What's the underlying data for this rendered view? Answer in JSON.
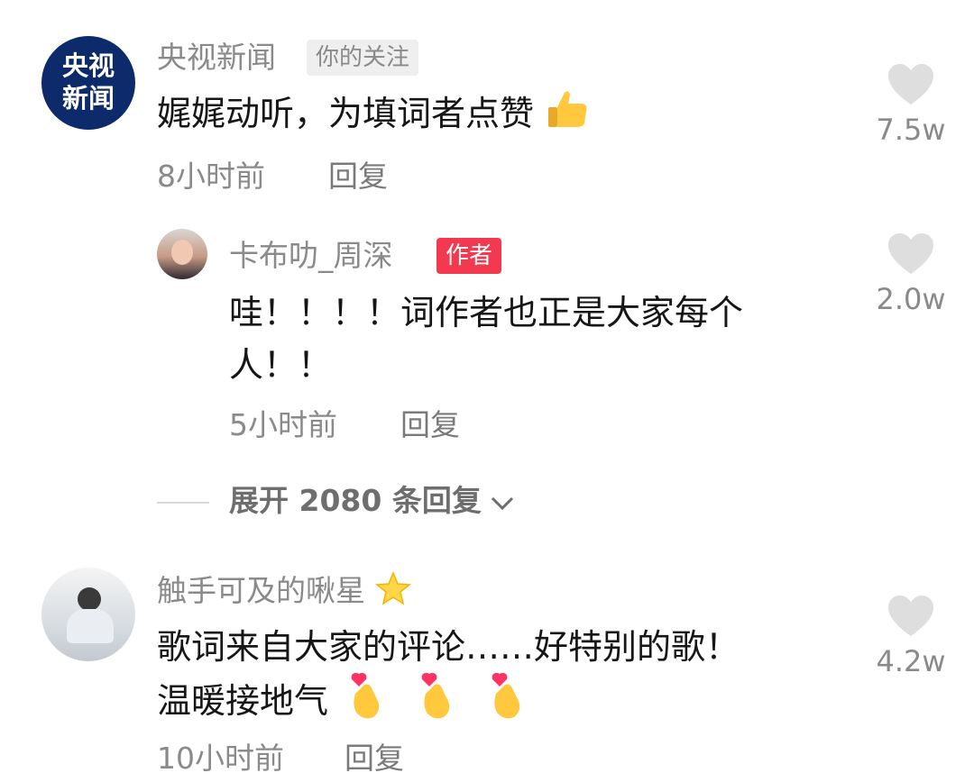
{
  "comments": [
    {
      "username": "央视新闻",
      "badge": "你的关注",
      "avatar_text_top": "央视",
      "avatar_text_bottom": "新闻",
      "text": "娓娓动听，为填词者点赞",
      "emoji": "thumbs-up",
      "time": "8小时前",
      "reply_label": "回复",
      "likes": "7.5w"
    },
    {
      "username": "触手可及的啾星",
      "name_emoji": "glowing-star",
      "text_line1": "歌词来自大家的评论……好特别的歌！",
      "text_line2": "温暖接地气",
      "emoji": "finger-heart",
      "time": "10小时前",
      "reply_label": "回复",
      "likes": "4.2w"
    }
  ],
  "reply": {
    "username": "卡布叻_周深",
    "badge": "作者",
    "text": "哇！！！！词作者也正是大家每个人！！",
    "time": "5小时前",
    "reply_label": "回复",
    "likes": "2.0w"
  },
  "expand_label": "展开 2080 条回复",
  "colors": {
    "badge_author_bg": "#f2394f",
    "secondary_text": "#8a8a8a",
    "primary_text": "#161616",
    "heart": "#dedede",
    "cctv_avatar_bg": "#0d2a6b"
  }
}
